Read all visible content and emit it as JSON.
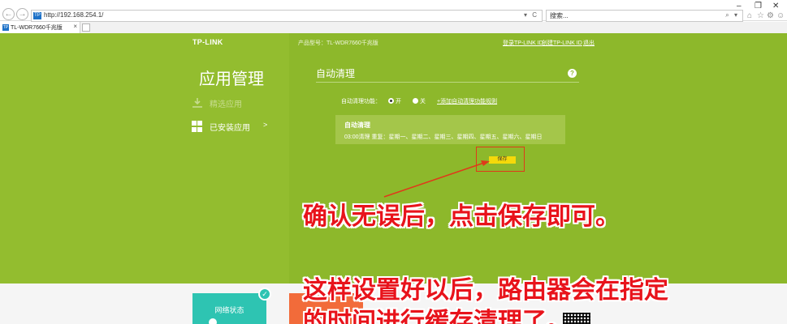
{
  "browser": {
    "url": "http://192.168.254.1/",
    "search_placeholder": "搜索...",
    "tab_title": "TL-WDR7660千兆版",
    "site_icon": "TP",
    "back_icon": "back-arrow",
    "forward_icon": "forward-arrow"
  },
  "header": {
    "logo": "TP-LINK",
    "model": "产品型号：TL-WDR7660千兆版",
    "login": "登录TP-LINK ID",
    "register": "创建TP-LINK ID",
    "logout": "退出"
  },
  "sidebar": {
    "title": "应用管理",
    "items": [
      {
        "label": "精选应用",
        "icon": "download-icon"
      },
      {
        "label": "已安装应用",
        "icon": "grid-icon",
        "arrow": ">"
      }
    ]
  },
  "main": {
    "section_title": "自动清理",
    "help": "?",
    "function_label": "自动清理功能：",
    "options": [
      {
        "label": "开",
        "checked": true
      },
      {
        "label": "关",
        "checked": false
      }
    ],
    "add_rule": "+添加自动清理功能规则",
    "rule": {
      "name": "自动清理",
      "detail": "03:00清理   重复：星期一、星期二、星期三、星期四、星期五、星期六、星期日"
    },
    "save_label": "保存"
  },
  "annotations": {
    "line1": "确认无误后，点击保存即可。",
    "line2": "这样设置好以后，路由器会在指定",
    "line3": "的时间进行缓存清理了。"
  },
  "tiles": {
    "network_status": "网络状态"
  },
  "colors": {
    "page_green": "#8db82b",
    "annotation_red": "#e8131b",
    "save_yellow": "#f5d90a",
    "tile_teal": "#2ec4b2",
    "tile_orange": "#f26b3a"
  }
}
